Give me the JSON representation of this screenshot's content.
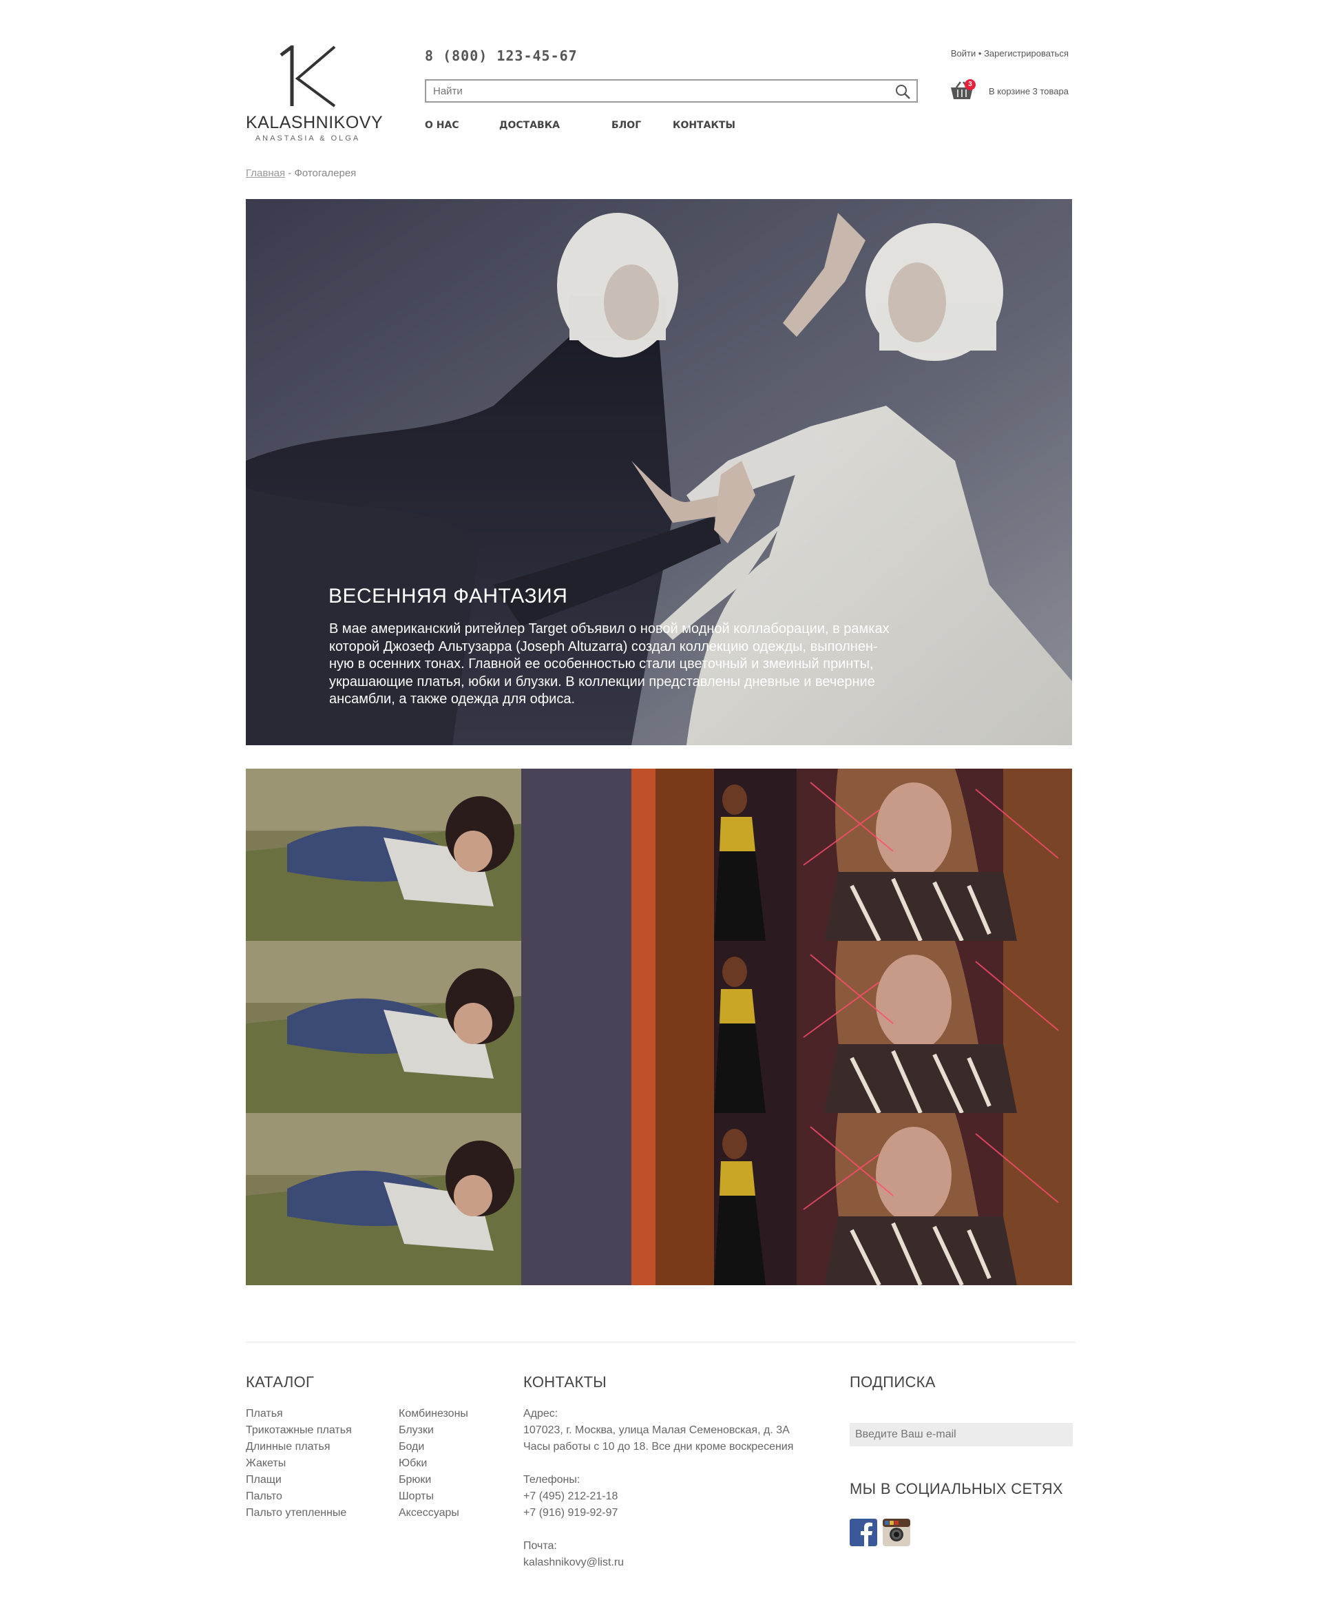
{
  "brand": {
    "name": "KALASHNIKOVY",
    "sub": "ANASTASIA & OLGA"
  },
  "header": {
    "phone": "8 (800) 123-45-67",
    "login": "Войти",
    "register": "Зарегистрироваться",
    "search_placeholder": "Найти",
    "cart_count": "3",
    "cart_text": "В корзине 3 товара"
  },
  "nav": [
    "О НАС",
    "ДОСТАВКА",
    "БЛОГ",
    "КОНТАКТЫ"
  ],
  "breadcrumb": {
    "home": "Главная",
    "sep": " - ",
    "current": "Фотогалерея"
  },
  "hero": {
    "title": "ВЕСЕННЯЯ ФАНТАЗИЯ",
    "lines": [
      "В мае американский ритейлер Target объявил о новой модной коллаборации, в рамках",
      "которой Джозеф Альтузарра (Joseph Altuzarra) создал коллекцию одежды, выполнен-",
      "ную в осенних тонах. Главной ее особенностью стали цветочный и змеиный принты,",
      "украшающие платья, юбки и блузки. В коллекции представлены дневные и вечерние",
      "ансамбли, а также одежда для офиса."
    ]
  },
  "footer": {
    "catalog_title": "КАТАЛОГ",
    "catalog_col1": [
      "Платья",
      "Трикотажные платья",
      "Длинные платья",
      "Жакеты",
      "Плащи",
      "Пальто",
      "Пальто утепленные"
    ],
    "catalog_col2": [
      "Комбинезоны",
      "Блузки",
      "Боди",
      "Юбки",
      "Брюки",
      "Шорты",
      "Аксессуары"
    ],
    "contacts_title": "КОНТАКТЫ",
    "address_label": "Адрес:",
    "address": "107023, г. Москва, улица Малая Семеновская, д. 3А",
    "hours": "Часы работы с 10 до 18. Все дни кроме воскресения",
    "phones_label": "Телефоны:",
    "phone1": "+7 (495) 212-21-18",
    "phone2": "+7 (916) 919-92-97",
    "mail_label": "Почта:",
    "mail": "kalashnikovy@list.ru",
    "subscribe_title": "ПОДПИСКА",
    "subscribe_placeholder": "Введите Ваш e-mail",
    "social_title": "МЫ В СОЦИАЛЬНЫХ СЕТЯХ"
  },
  "icons": {
    "search": "search-icon",
    "cart": "basket-icon",
    "facebook": "facebook-icon",
    "instagram": "instagram-icon"
  },
  "colors": {
    "badge": "#e8203a",
    "facebook": "#3b5998"
  }
}
